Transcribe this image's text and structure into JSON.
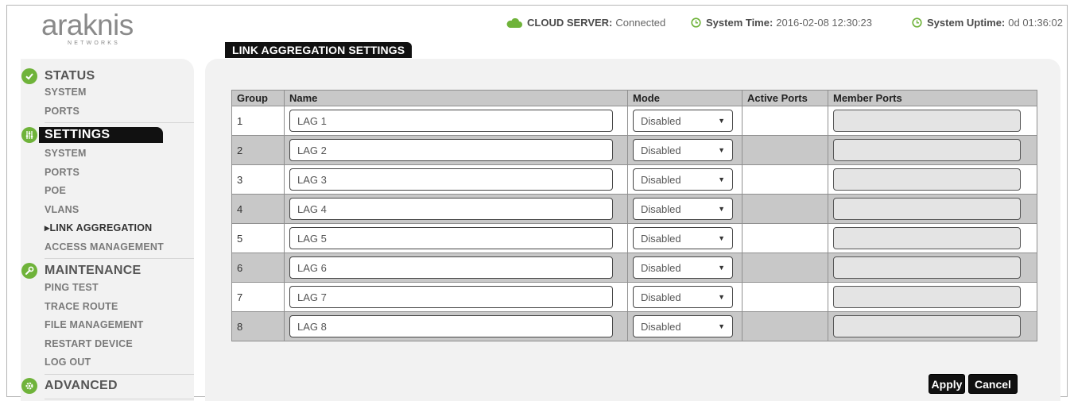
{
  "logo": {
    "word": "araknis",
    "sub": "NETWORKS"
  },
  "header": {
    "cloud_label": "CLOUD SERVER:",
    "cloud_value": "Connected",
    "time_label": "System Time:",
    "time_value": "2016-02-08 12:30:23",
    "uptime_label": "System Uptime:",
    "uptime_value": "0d 01:36:02"
  },
  "page_title": "LINK AGGREGATION SETTINGS",
  "sidebar": {
    "status": {
      "label": "STATUS",
      "items": [
        "SYSTEM",
        "PORTS"
      ]
    },
    "settings": {
      "label": "SETTINGS",
      "items": [
        "SYSTEM",
        "PORTS",
        "POE",
        "VLANS",
        "▸LINK AGGREGATION",
        "ACCESS MANAGEMENT"
      ]
    },
    "maintenance": {
      "label": "MAINTENANCE",
      "items": [
        "PING TEST",
        "TRACE ROUTE",
        "FILE MANAGEMENT",
        "RESTART DEVICE",
        "LOG OUT"
      ]
    },
    "advanced": {
      "label": "ADVANCED"
    }
  },
  "table": {
    "headers": {
      "group": "Group",
      "name": "Name",
      "mode": "Mode",
      "active": "Active Ports",
      "member": "Member Ports"
    },
    "rows": [
      {
        "group": "1",
        "name": "LAG 1",
        "mode": "Disabled",
        "active": ""
      },
      {
        "group": "2",
        "name": "LAG 2",
        "mode": "Disabled",
        "active": ""
      },
      {
        "group": "3",
        "name": "LAG 3",
        "mode": "Disabled",
        "active": ""
      },
      {
        "group": "4",
        "name": "LAG 4",
        "mode": "Disabled",
        "active": ""
      },
      {
        "group": "5",
        "name": "LAG 5",
        "mode": "Disabled",
        "active": ""
      },
      {
        "group": "6",
        "name": "LAG 6",
        "mode": "Disabled",
        "active": ""
      },
      {
        "group": "7",
        "name": "LAG 7",
        "mode": "Disabled",
        "active": ""
      },
      {
        "group": "8",
        "name": "LAG 8",
        "mode": "Disabled",
        "active": ""
      }
    ]
  },
  "buttons": {
    "apply": "Apply",
    "cancel": "Cancel"
  },
  "colors": {
    "accent_green": "#6fb33a",
    "dark": "#111111",
    "panel_bg": "#f2f2f2",
    "row_gray": "#c8c8c8"
  }
}
